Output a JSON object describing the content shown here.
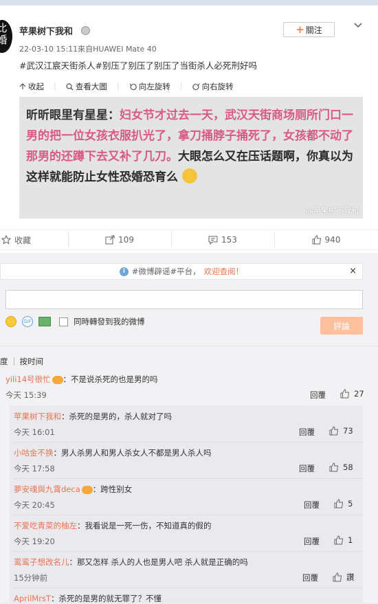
{
  "post": {
    "avatar_lines": [
      "比",
      "婚"
    ],
    "username": "苹果树下我和",
    "follow_label": "關注",
    "meta": "22-03-10 15:11來自HUAWEI Mate 40",
    "text": "#武汉江宸天街杀人#别压了别压了别压了当街杀人必死刑好吗"
  },
  "media_toolbar": {
    "collapse": "收起",
    "view_large": "查看大圖",
    "rotate_left": "向左旋转",
    "rotate_right": "向右旋转"
  },
  "image": {
    "nick": "昕昕眼里有星星：",
    "body": "妇女节才过去一天，武汉天街商场厕所门口一男的把一位女孩衣服扒光了，拿刀捅脖子捅死了，女孩都不动了那男的还蹲下去又补了几刀。",
    "tail": "大眼怎么又在压话题啊，你真以为这样就能防止女性恐婚恐育么",
    "watermark": "@苹果树下我和"
  },
  "actions": {
    "favorite": "收藏",
    "repost": "109",
    "comment": "153",
    "like": "940"
  },
  "notice": {
    "prefix": "#微博辟谣#平台，",
    "highlight": "欢迎查阅！",
    "close": "×"
  },
  "composer": {
    "repost_checkbox_label": "同時轉發到我的微博",
    "submit_label": "評論"
  },
  "sort": {
    "left_fragment": "度",
    "by_time": "按时间"
  },
  "comments": [
    {
      "user": "yili14号很忙",
      "text": "：不是说杀死的也是男的吗",
      "time": "今天 15:39",
      "reply": "回覆",
      "likes": "27",
      "vip": true
    },
    {
      "user": "苹果树下我和",
      "text": "：杀死的是男的，杀人就对了吗",
      "time": "今天 16:01",
      "reply": "回覆",
      "likes": "73",
      "vip": false
    },
    {
      "user": "小咕金不换",
      "text": "：男人杀男人和男人杀女人不都是男人杀人吗",
      "time": "今天 17:58",
      "reply": "回覆",
      "likes": "58",
      "vip": false
    },
    {
      "user": "夢安魂與九霄deca",
      "text": "：跨性别女",
      "time": "今天 20:45",
      "reply": "回覆",
      "likes": "5",
      "vip": true
    },
    {
      "user": "不爱吃青菜的柚左",
      "text": "：我看说是一死一伤，不知道真的假的",
      "time": "今天 19:20",
      "reply": "回覆",
      "likes": "1",
      "vip": false
    },
    {
      "user": "鸾鸾子想改名儿",
      "text": "：那又怎样 杀人的人也是男人吧 杀人就是正确的吗",
      "time": "15分钟前",
      "reply": "回覆",
      "likes": "讚",
      "vip": false
    },
    {
      "user": "AprilMrsT",
      "text": "：杀死的是男的就无罪了？不懂",
      "time": "",
      "reply": "",
      "likes": "",
      "vip": false
    }
  ]
}
